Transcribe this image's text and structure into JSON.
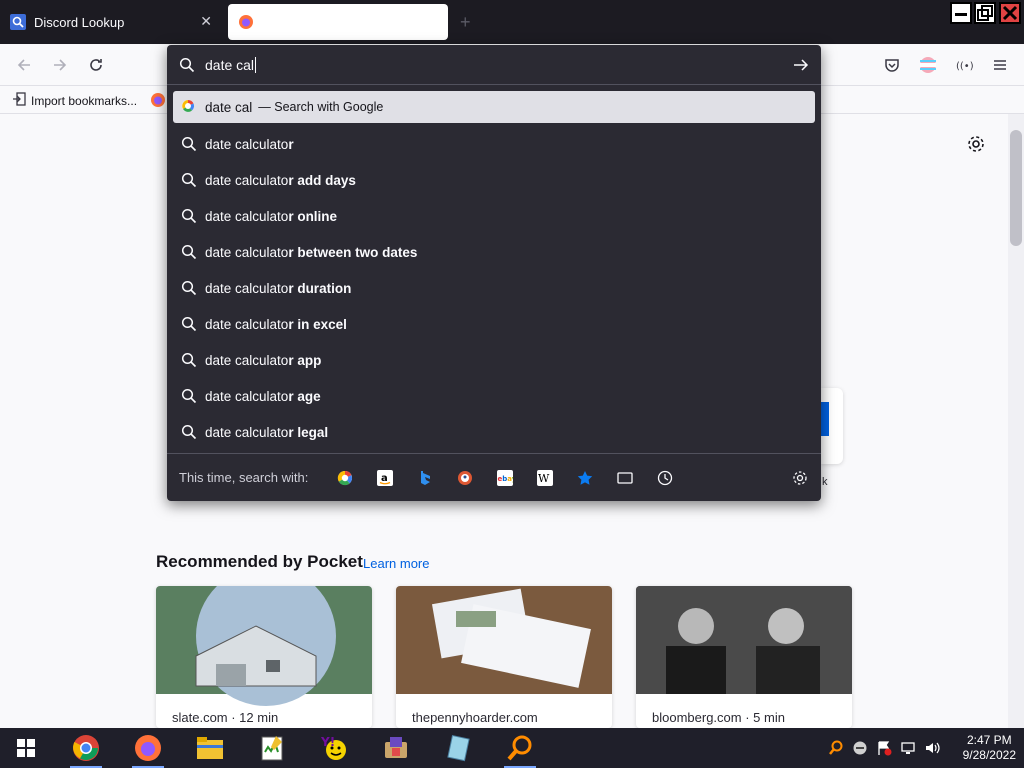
{
  "tabs": [
    {
      "title": "Discord Lookup"
    },
    {
      "title": ""
    }
  ],
  "toolbar": {
    "bookmark_import": "Import bookmarks..."
  },
  "urlbar": {
    "value": "date cal",
    "suggestions": [
      {
        "typed": "date cal",
        "rest": "",
        "meta": "— Search with Google",
        "engine": "google"
      },
      {
        "typed": "date calculato",
        "rest": "r",
        "meta": ""
      },
      {
        "typed": "date calculato",
        "rest": "r add days",
        "meta": ""
      },
      {
        "typed": "date calculato",
        "rest": "r online",
        "meta": ""
      },
      {
        "typed": "date calculato",
        "rest": "r between two dates",
        "meta": ""
      },
      {
        "typed": "date calculato",
        "rest": "r duration",
        "meta": ""
      },
      {
        "typed": "date calculato",
        "rest": "r in excel",
        "meta": ""
      },
      {
        "typed": "date calculato",
        "rest": "r app",
        "meta": ""
      },
      {
        "typed": "date calculato",
        "rest": "r age",
        "meta": ""
      },
      {
        "typed": "date calculato",
        "rest": "r legal",
        "meta": ""
      }
    ],
    "oneoff_label": "This time, search with:",
    "engines": [
      "google-icon",
      "amazon-icon",
      "bing-icon",
      "duckduckgo-icon",
      "ebay-icon",
      "wikipedia-icon",
      "bookmarks-icon",
      "tabs-icon",
      "history-icon"
    ]
  },
  "pocket": {
    "title": "Recommended by Pocket",
    "learn_more": "Learn more",
    "cards": [
      {
        "source": "slate.com · 12 min"
      },
      {
        "source": "thepennyhoarder.com"
      },
      {
        "source": "bloomberg.com · 5 min"
      }
    ]
  },
  "clock": {
    "time": "2:47 PM",
    "date": "9/28/2022"
  },
  "colors": {
    "panel": "#2b2a33",
    "accent": "#0061e0",
    "tabstrip": "#1c1b22"
  }
}
